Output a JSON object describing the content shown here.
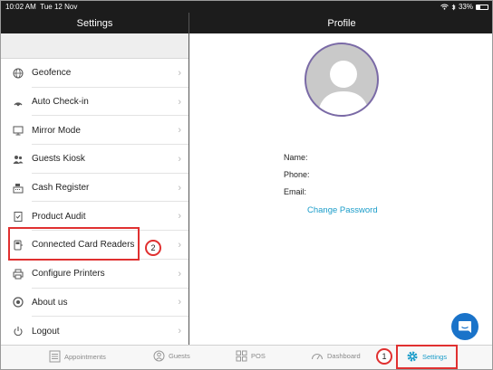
{
  "status_bar": {
    "time": "10:02 AM",
    "date": "Tue 12 Nov",
    "battery": "33%"
  },
  "left_header": {
    "title": "Settings"
  },
  "right_header": {
    "title": "Profile"
  },
  "settings_items": [
    {
      "label": "Geofence",
      "icon": "globe-icon"
    },
    {
      "label": "Auto Check-in",
      "icon": "signal-icon"
    },
    {
      "label": "Mirror Mode",
      "icon": "monitor-icon"
    },
    {
      "label": "Guests Kiosk",
      "icon": "users-icon"
    },
    {
      "label": "Cash Register",
      "icon": "register-icon"
    },
    {
      "label": "Product Audit",
      "icon": "clipboard-check-icon"
    },
    {
      "label": "Connected Card Readers",
      "icon": "card-reader-icon"
    },
    {
      "label": "Configure Printers",
      "icon": "printer-icon"
    },
    {
      "label": "About us",
      "icon": "info-icon"
    },
    {
      "label": "Logout",
      "icon": "power-icon"
    }
  ],
  "profile": {
    "name_label": "Name:",
    "phone_label": "Phone:",
    "email_label": "Email:",
    "change_password": "Change Password"
  },
  "tabs": [
    {
      "label": "Appointments",
      "icon": "calendar-list-icon"
    },
    {
      "label": "Guests",
      "icon": "guests-icon"
    },
    {
      "label": "POS",
      "icon": "grid-icon"
    },
    {
      "label": "Dashboard",
      "icon": "gauge-icon"
    },
    {
      "label": "Settings",
      "icon": "gear-icon",
      "active": true
    }
  ],
  "annotations": {
    "step1": "1",
    "step2": "2"
  },
  "colors": {
    "accent": "#1a9cc9",
    "annotation": "#e03030",
    "header": "#1c1c1c"
  }
}
